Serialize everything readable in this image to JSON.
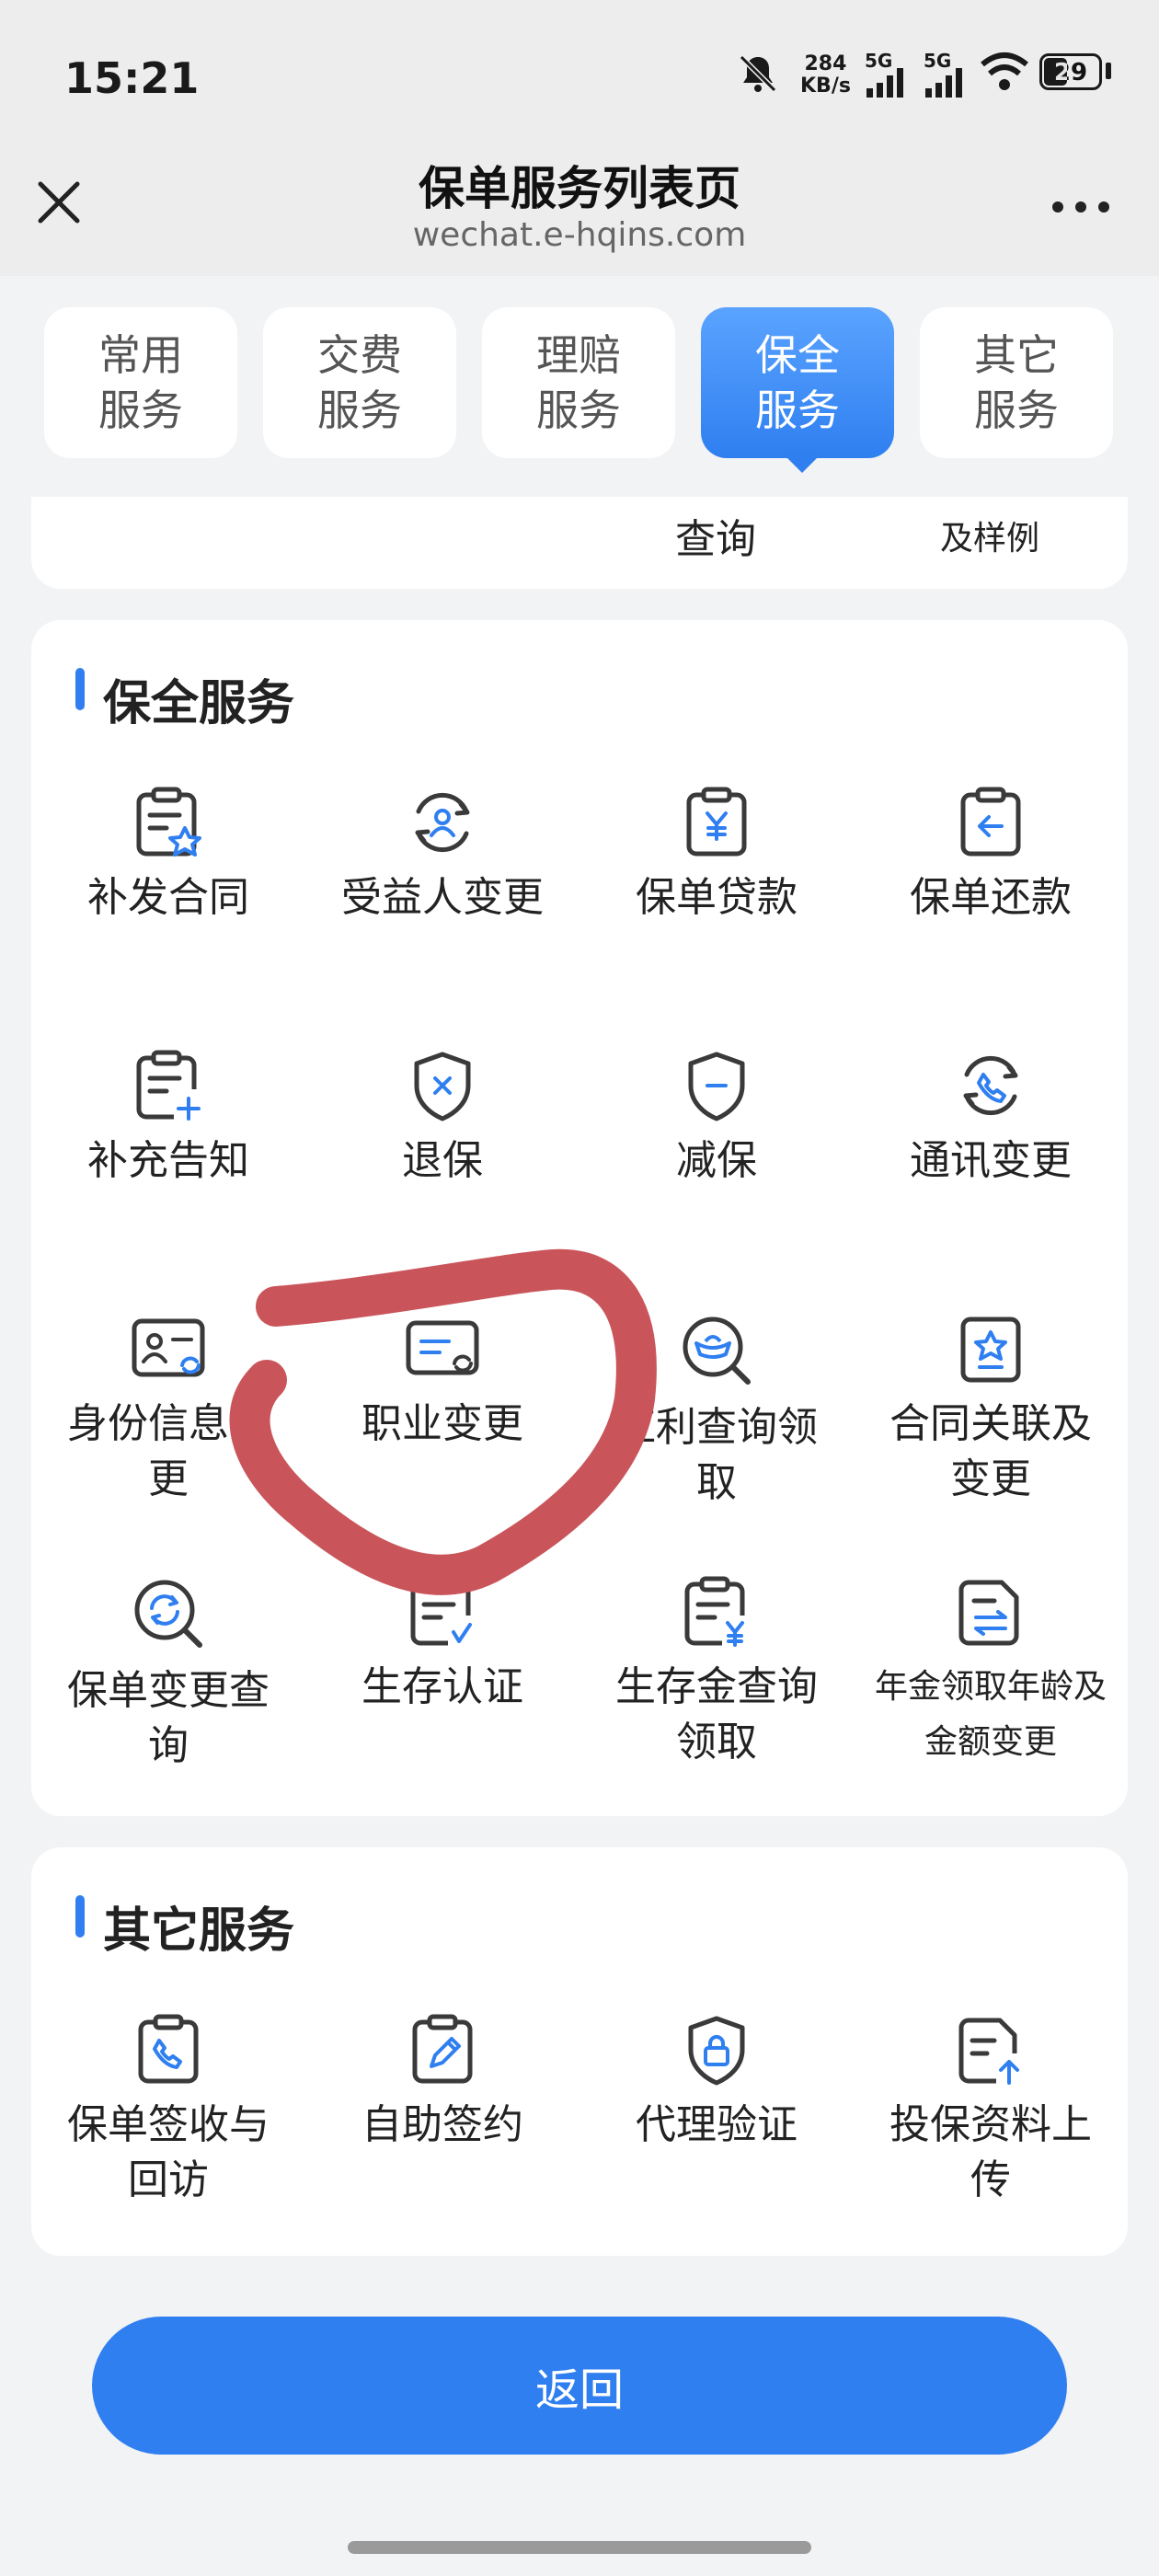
{
  "status_bar": {
    "time": "15:21",
    "net_speed_value": "284",
    "net_speed_unit": "KB/s",
    "signal1": "5G",
    "signal2": "5G",
    "battery": "29"
  },
  "header": {
    "title": "保单服务列表页",
    "url": "wechat.e-hqins.com"
  },
  "tabs": [
    {
      "label": "常用服务"
    },
    {
      "label": "交费服务"
    },
    {
      "label": "理赔服务"
    },
    {
      "label": "保全服务",
      "active": true
    },
    {
      "label": "其它服务"
    }
  ],
  "previous_card": {
    "partial_labels": [
      "查询",
      "及样例"
    ]
  },
  "preservation": {
    "title": "保全服务",
    "items": [
      {
        "label": "补发合同",
        "icon": "doc-star-icon"
      },
      {
        "label": "受益人变更",
        "icon": "person-cycle-icon"
      },
      {
        "label": "保单贷款",
        "icon": "yen-clipboard-icon"
      },
      {
        "label": "保单还款",
        "icon": "return-clipboard-icon"
      },
      {
        "label": "补充告知",
        "icon": "doc-plus-icon"
      },
      {
        "label": "退保",
        "icon": "shield-x-icon"
      },
      {
        "label": "减保",
        "icon": "shield-minus-icon"
      },
      {
        "label": "通讯变更",
        "icon": "phone-cycle-icon"
      },
      {
        "label": "身份信息变更",
        "icon": "id-card-icon"
      },
      {
        "label": "职业变更",
        "icon": "job-card-icon"
      },
      {
        "label": "红利查询领取",
        "icon": "ingot-search-icon"
      },
      {
        "label": "合同关联及变更",
        "icon": "star-clipboard-icon"
      },
      {
        "label": "保单变更查询",
        "icon": "search-cycle-icon"
      },
      {
        "label": "生存认证",
        "icon": "doc-check-icon"
      },
      {
        "label": "生存金查询领取",
        "icon": "doc-yen-icon"
      },
      {
        "label": "年金领取年龄及金额变更",
        "icon": "doc-swap-icon"
      }
    ]
  },
  "other": {
    "title": "其它服务",
    "items": [
      {
        "label": "保单签收与回访",
        "icon": "phone-clipboard-icon"
      },
      {
        "label": "自助签约",
        "icon": "pen-clipboard-icon"
      },
      {
        "label": "代理验证",
        "icon": "shield-lock-icon"
      },
      {
        "label": "投保资料上传",
        "icon": "doc-upload-icon"
      }
    ]
  },
  "footer": {
    "back_label": "返回"
  },
  "colors": {
    "accent": "#2f7ff0",
    "icon_dark": "#3a3a3a",
    "annotation": "#c9555b"
  }
}
